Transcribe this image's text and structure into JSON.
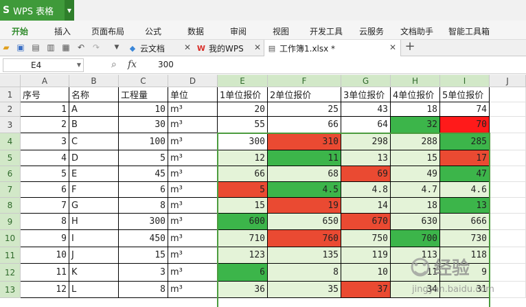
{
  "app": {
    "title": "WPS 表格",
    "logo": "S",
    "accent": "#3f9a3a"
  },
  "menu": [
    "开始",
    "插入",
    "页面布局",
    "公式",
    "数据",
    "审阅",
    "视图",
    "开发工具",
    "云服务",
    "文档助手",
    "智能工具箱"
  ],
  "doc_tabs": [
    {
      "label": "云文档",
      "icon": "cloud-icon",
      "active": false
    },
    {
      "label": "我的WPS",
      "icon": "wps-icon",
      "active": false
    },
    {
      "label": "工作簿1.xlsx *",
      "icon": "sheet-icon",
      "active": true
    }
  ],
  "formula": {
    "cell_ref": "E4",
    "fx": "fx",
    "value": "300"
  },
  "columns": [
    "A",
    "B",
    "C",
    "D",
    "E",
    "F",
    "G",
    "H",
    "I",
    "J"
  ],
  "selected_columns": [
    "E",
    "F",
    "G",
    "H",
    "I"
  ],
  "rows": [
    [
      "序号",
      "名称",
      "工程量",
      "单位",
      "1单位报价",
      "2单位报价",
      "3单位报价",
      "4单位报价",
      "5单位报价"
    ],
    [
      "1",
      "A",
      "10",
      "m³",
      "20",
      "25",
      "43",
      "18",
      "74"
    ],
    [
      "2",
      "B",
      "30",
      "m³",
      "55",
      "66",
      "64",
      "32",
      "70"
    ],
    [
      "3",
      "C",
      "100",
      "m³",
      "300",
      "310",
      "298",
      "288",
      "285"
    ],
    [
      "4",
      "D",
      "5",
      "m³",
      "12",
      "11",
      "13",
      "15",
      "17"
    ],
    [
      "5",
      "E",
      "45",
      "m³",
      "66",
      "68",
      "69",
      "49",
      "47"
    ],
    [
      "6",
      "F",
      "6",
      "m³",
      "5",
      "4.5",
      "4.8",
      "4.7",
      "4.6"
    ],
    [
      "7",
      "G",
      "8",
      "m³",
      "15",
      "19",
      "14",
      "18",
      "13"
    ],
    [
      "8",
      "H",
      "300",
      "m³",
      "600",
      "650",
      "670",
      "630",
      "666"
    ],
    [
      "9",
      "I",
      "450",
      "m³",
      "710",
      "760",
      "750",
      "700",
      "730"
    ],
    [
      "10",
      "J",
      "15",
      "m³",
      "123",
      "135",
      "119",
      "113",
      "118"
    ],
    [
      "11",
      "K",
      "3",
      "m³",
      "6",
      "8",
      "10",
      "11",
      "9"
    ],
    [
      "12",
      "L",
      "8",
      "m³",
      "36",
      "35",
      "37",
      "34",
      "31"
    ]
  ],
  "cell_colors": [
    [
      "",
      "",
      "",
      "",
      "",
      "",
      "",
      "",
      ""
    ],
    [
      "",
      "",
      "",
      "",
      "",
      "",
      "",
      "",
      ""
    ],
    [
      "",
      "",
      "",
      "",
      "",
      "",
      "",
      "green",
      "red"
    ],
    [
      "",
      "",
      "",
      "",
      "white",
      "orange",
      "light",
      "light",
      "green"
    ],
    [
      "",
      "",
      "",
      "",
      "light",
      "green",
      "light",
      "light",
      "orange"
    ],
    [
      "",
      "",
      "",
      "",
      "light",
      "light",
      "orange",
      "light",
      "green"
    ],
    [
      "",
      "",
      "",
      "",
      "orange",
      "green",
      "light",
      "light",
      "light"
    ],
    [
      "",
      "",
      "",
      "",
      "light",
      "orange",
      "light",
      "light",
      "green"
    ],
    [
      "",
      "",
      "",
      "",
      "green",
      "light",
      "orange",
      "light",
      "light"
    ],
    [
      "",
      "",
      "",
      "",
      "light",
      "orange",
      "light",
      "green",
      "light"
    ],
    [
      "",
      "",
      "",
      "",
      "light",
      "light",
      "light",
      "light",
      "light"
    ],
    [
      "",
      "",
      "",
      "",
      "green",
      "light",
      "light",
      "light",
      "light"
    ],
    [
      "",
      "",
      "",
      "",
      "light",
      "light",
      "orange",
      "light",
      "light"
    ]
  ],
  "palette": {
    "green": "#3cb54a",
    "red": "#ff1a1a",
    "orange": "#ea4a32",
    "light": "#e4f3d8",
    "white": "#ffffff",
    "none": "#ffffff"
  },
  "watermark": {
    "title": "经验",
    "subtitle": "jingyan.baidu.com"
  }
}
